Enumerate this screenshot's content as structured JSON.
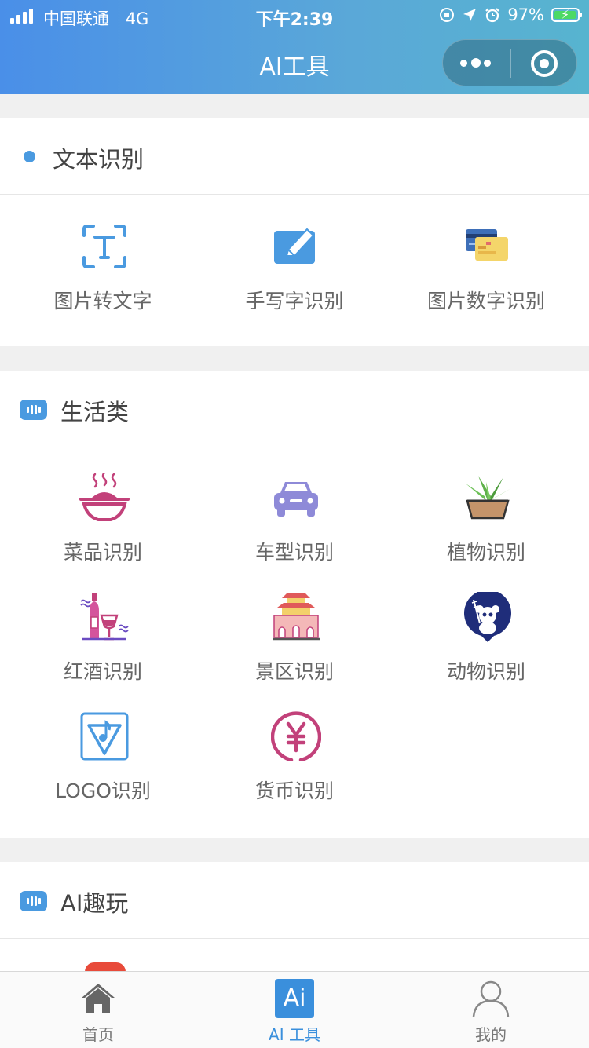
{
  "status_bar": {
    "carrier": "中国联通",
    "network": "4G",
    "time": "下午2:39",
    "battery": "97%"
  },
  "nav": {
    "title": "AI工具"
  },
  "sections": {
    "text": {
      "title": "文本识别",
      "items": [
        {
          "label": "图片转文字",
          "icon": "text-frame-icon"
        },
        {
          "label": "手写字识别",
          "icon": "pencil-edit-icon"
        },
        {
          "label": "图片数字识别",
          "icon": "cards-icon"
        }
      ]
    },
    "life": {
      "title": "生活类",
      "items": [
        {
          "label": "菜品识别",
          "icon": "dish-bowl-icon"
        },
        {
          "label": "车型识别",
          "icon": "car-icon"
        },
        {
          "label": "植物识别",
          "icon": "potted-plant-icon"
        },
        {
          "label": "红酒识别",
          "icon": "wine-icon"
        },
        {
          "label": "景区识别",
          "icon": "landmark-gate-icon"
        },
        {
          "label": "动物识别",
          "icon": "panda-icon"
        },
        {
          "label": "LOGO识别",
          "icon": "logo-triangle-icon"
        },
        {
          "label": "货币识别",
          "icon": "yuan-coin-icon"
        }
      ]
    },
    "fun": {
      "title": "AI趣玩"
    }
  },
  "tabbar": {
    "items": [
      {
        "label": "首页",
        "icon": "home-icon"
      },
      {
        "label": "AI 工具",
        "icon": "ai-icon",
        "badge_text": "Ai"
      },
      {
        "label": "我的",
        "icon": "user-icon"
      }
    ],
    "active_index": 1
  },
  "colors": {
    "accent": "#4a9ae0",
    "active_tab": "#3a8fdc",
    "header_gradient_start": "#4a8fe8",
    "header_gradient_end": "#57b4cf"
  }
}
